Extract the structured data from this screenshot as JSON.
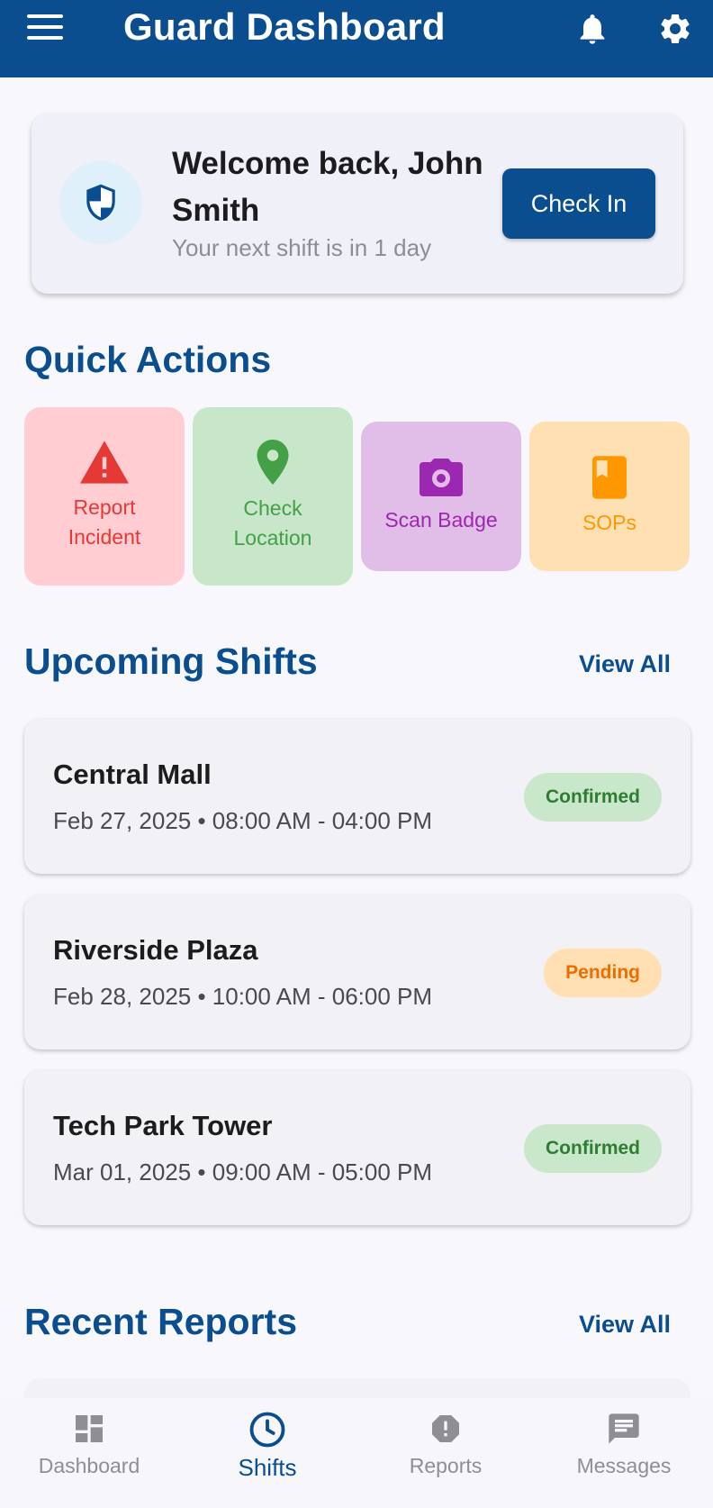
{
  "app_bar": {
    "title": "Guard Dashboard",
    "icons": [
      "menu-icon",
      "bell-icon",
      "gear-icon"
    ],
    "color": "#0b4e8f"
  },
  "welcome": {
    "greeting": "Welcome back, John Smith",
    "subtitle": "Your next shift is in 1 day",
    "check_in_label": "Check In",
    "icon": "shield-icon"
  },
  "quick_actions": {
    "title": "Quick Actions",
    "items": [
      {
        "label": "Report Incident",
        "icon": "warning-icon",
        "bg": "#ffcdd2",
        "color": "#e53935"
      },
      {
        "label": "Check Location",
        "icon": "location-pin-icon",
        "bg": "#c8e6c9",
        "color": "#43a047"
      },
      {
        "label": "Scan Badge",
        "icon": "camera-icon",
        "bg": "#e1bee7",
        "color": "#9c27b0"
      },
      {
        "label": "SOPs",
        "icon": "book-icon",
        "bg": "#ffe0b2",
        "color": "#ff9800"
      }
    ]
  },
  "upcoming_shifts": {
    "title": "Upcoming Shifts",
    "view_all": "View All",
    "items": [
      {
        "place": "Central Mall",
        "time": "Feb 27, 2025 • 08:00 AM - 04:00 PM",
        "status": "Confirmed"
      },
      {
        "place": "Riverside Plaza",
        "time": "Feb 28, 2025 • 10:00 AM - 06:00 PM",
        "status": "Pending"
      },
      {
        "place": "Tech Park Tower",
        "time": "Mar 01, 2025 • 09:00 AM - 05:00 PM",
        "status": "Confirmed"
      }
    ]
  },
  "recent_reports": {
    "title": "Recent Reports",
    "view_all": "View All"
  },
  "bottom_nav": {
    "items": [
      {
        "label": "Dashboard",
        "icon": "dashboard-icon",
        "active": false
      },
      {
        "label": "Shifts",
        "icon": "clock-icon",
        "active": true
      },
      {
        "label": "Reports",
        "icon": "alert-circle-icon",
        "active": false
      },
      {
        "label": "Messages",
        "icon": "message-icon",
        "active": false
      }
    ]
  }
}
